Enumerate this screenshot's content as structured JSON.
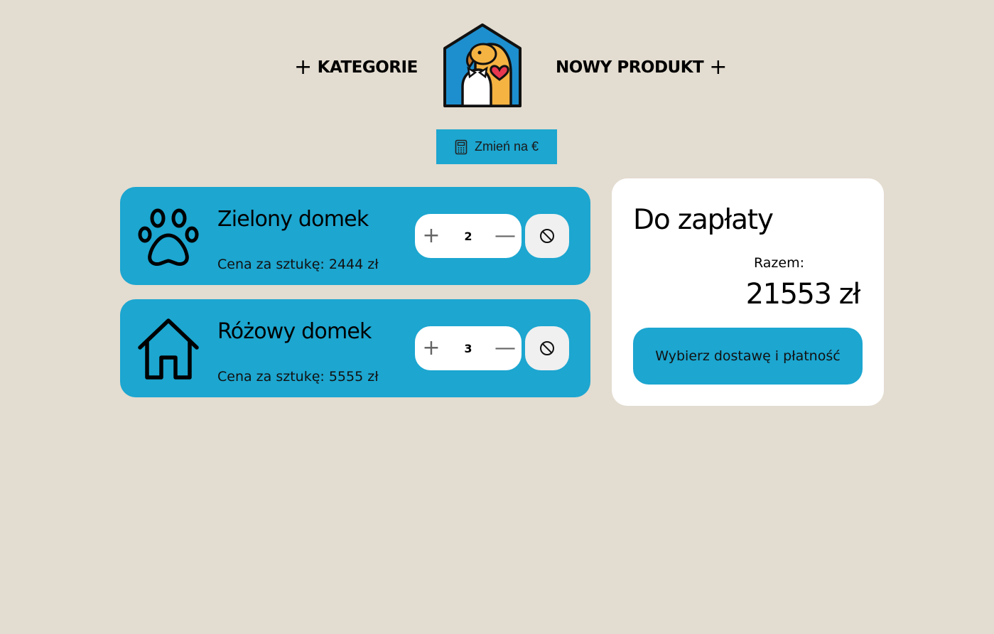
{
  "nav": {
    "categories_label": "KATEGORIE",
    "new_product_label": "NOWY PRODUKT",
    "plus_glyph": "+"
  },
  "currency_button": {
    "label": "Zmień na €",
    "icon": "calculator-icon"
  },
  "cart": {
    "items": [
      {
        "name": "Zielony domek",
        "price_label": "Cena za sztukę: 2444 zł",
        "quantity": "2",
        "icon": "paw-icon"
      },
      {
        "name": "Różowy domek",
        "price_label": "Cena za sztukę: 5555 zł",
        "quantity": "3",
        "icon": "house-icon"
      }
    ],
    "step_plus": "+",
    "step_minus": "—"
  },
  "summary": {
    "title": "Do zapłaty",
    "total_label": "Razem:",
    "total_value": "21553 zł",
    "checkout_label": "Wybierz dostawę i płatność"
  },
  "colors": {
    "background": "#e3dcd0",
    "accent": "#1ca6d0",
    "card": "#ffffff"
  }
}
